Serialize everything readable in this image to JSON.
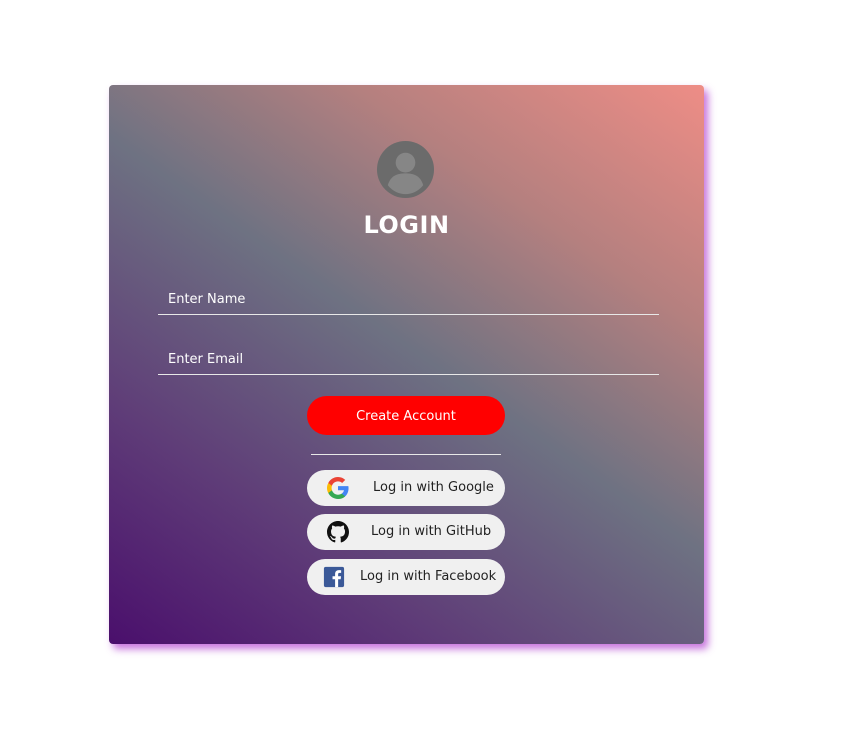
{
  "login_card": {
    "title": "LOGIN",
    "avatar_icon": "user-circle-icon",
    "name_placeholder": "Enter Name",
    "email_placeholder": "Enter Email",
    "create_button_label": "Create Account",
    "social": [
      {
        "label": "Log in with Google",
        "icon": "google-icon"
      },
      {
        "label": "Log in with GitHub",
        "icon": "github-icon"
      },
      {
        "label": "Log in with Facebook",
        "icon": "facebook-icon"
      }
    ]
  },
  "colors": {
    "create_button": "#ff0000",
    "gradient_start": "#4a0f6c",
    "gradient_end": "#ee8d86",
    "social_button_bg": "#f0f0f0",
    "card_shadow": "#b446d2"
  }
}
